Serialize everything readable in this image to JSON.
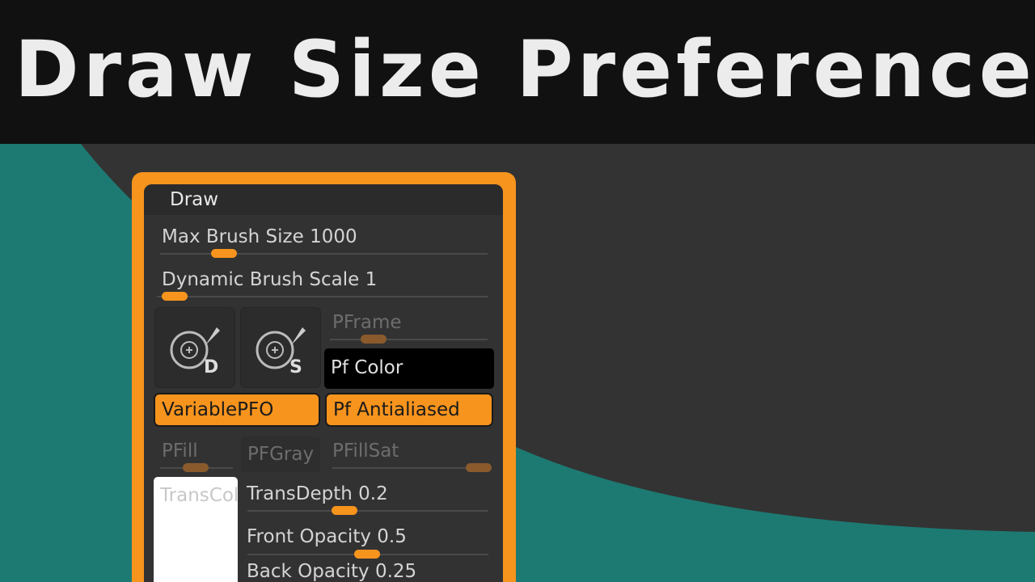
{
  "title": "Draw Size Preferences",
  "colors": {
    "accent": "#f7941d",
    "teal": "#1d7a73",
    "panel": "#323232"
  },
  "panel": {
    "header": "Draw",
    "max_brush_size": {
      "label": "Max Brush Size",
      "value": "1000",
      "fraction": 0.08
    },
    "dynamic_brush_scale": {
      "label": "Dynamic Brush Scale",
      "value": "1",
      "fraction": 0.0
    },
    "icon_buttons": [
      {
        "name": "draw-size-icon",
        "letter": "D"
      },
      {
        "name": "brush-size-icon",
        "letter": "S"
      }
    ],
    "pframe": {
      "label": "PFrame",
      "fraction": 0.25
    },
    "pf_color": "Pf Color",
    "variable_pfo": "VariablePFO",
    "pf_antialiased": "Pf Antialiased",
    "pfill": {
      "label": "PFill",
      "fraction": 0.4
    },
    "pfgray": "PFGray",
    "pfillsat": {
      "label": "PFillSat",
      "fraction": 1.0
    },
    "trans_color": "TransColor",
    "trans_depth": {
      "label": "TransDepth",
      "value": "0.2",
      "fraction": 0.4
    },
    "front_opacity": {
      "label": "Front Opacity",
      "value": "0.5",
      "fraction": 0.5
    },
    "back_opacity": {
      "label": "Back Opacity",
      "value": "0.25"
    }
  }
}
